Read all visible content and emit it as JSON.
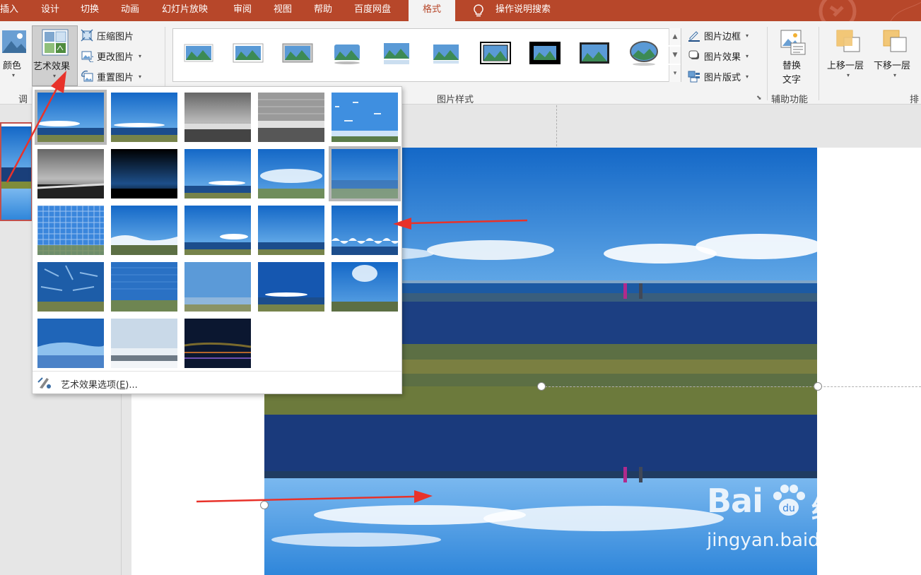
{
  "tabs": {
    "insert": "插入",
    "design": "设计",
    "transitions": "切换",
    "animations": "动画",
    "slideshow": "幻灯片放映",
    "review": "审阅",
    "view": "视图",
    "help": "帮助",
    "baidu": "百度网盘",
    "format": "格式",
    "tell_me": "操作说明搜索"
  },
  "ribbon": {
    "adjust": {
      "color": "颜色",
      "art_effects": "艺术效果",
      "compress": "压缩图片",
      "change": "更改图片",
      "reset": "重置图片",
      "group_label_partial": "调"
    },
    "picture_styles": {
      "group_label": "图片样式",
      "border": "图片边框",
      "effects": "图片效果",
      "layout": "图片版式"
    },
    "accessibility": {
      "alt_text_line1": "替换",
      "alt_text_line2": "文字",
      "group_label": "辅助功能"
    },
    "arrange": {
      "bring_forward": "上移一层",
      "send_backward": "下移一层",
      "group_label_partial": "排"
    }
  },
  "art_effects_menu": {
    "options_label": "艺术效果选项(",
    "options_key": "E",
    "options_suffix": ")..."
  },
  "watermark": {
    "brand": "Bai",
    "brand_tail": "经验",
    "url": "jingyan.baidu.com"
  },
  "colors": {
    "tab_bar": "#b7472a",
    "ribbon_bg": "#f3f3f3",
    "accent_red": "#e8322a"
  },
  "icons": [
    "lightbulb-icon",
    "color-icon",
    "art-effects-icon",
    "compress-icon",
    "change-picture-icon",
    "reset-picture-icon",
    "picture-border-icon",
    "picture-effects-icon",
    "picture-layout-icon",
    "alt-text-icon",
    "bring-forward-icon",
    "send-backward-icon",
    "art-effect-options-icon"
  ]
}
